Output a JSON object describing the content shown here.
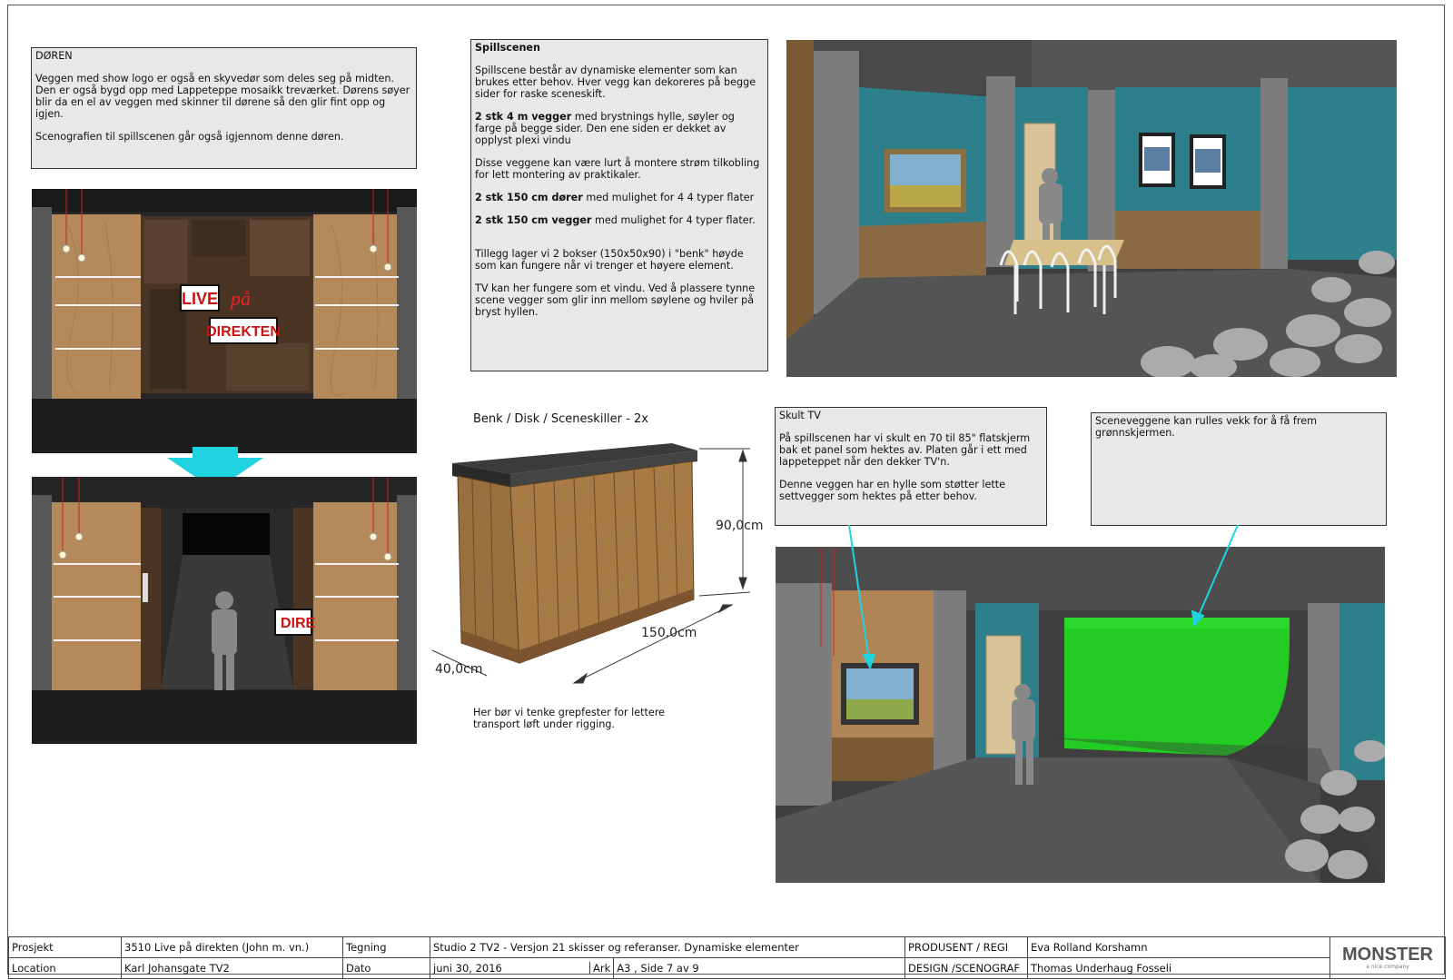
{
  "door_note": {
    "title": "DØREN",
    "p1": "Veggen med show logo er også en skyvedør som deles seg på midten. Den er også bygd opp med Lappeteppe mosaikk treværket. Dørens søyer blir da en el av veggen med skinner til dørene så den glir fint opp og igjen.",
    "p2": "Scenografien til spillscenen går også igjennom denne døren."
  },
  "stage_note": {
    "title": "Spillscenen",
    "intro": "Spillscene består av dynamiske elementer som kan brukes etter behov. Hver vegg kan dekoreres på begge sider for raske sceneskift.",
    "walls_bold": "2 stk 4 m vegger",
    "walls_rest": " med brystnings hylle, søyler og farge på begge sider. Den ene siden er dekket av opplyst plexi vindu",
    "power": "Disse veggene kan være lurt å montere strøm tilkobling for lett montering av praktikaler.",
    "doors_bold": "2 stk 150 cm dører",
    "doors_rest": " med mulighet for 4 4 typer flater",
    "walls150_bold": "2 stk 150 cm vegger",
    "walls150_rest": " med mulighet for 4 typer flater.",
    "boxes": "Tillegg lager vi 2 bokser (150x50x90) i \"benk\" høyde som kan fungere når vi trenger et høyere element.",
    "tv": "TV kan her fungere som et vindu. Ved å plassere tynne scene vegger som glir inn mellom søylene og hviler på bryst hyllen."
  },
  "bench": {
    "title": "Benk / Disk / Sceneskiller - 2x",
    "height": "90,0cm",
    "width": "150,0cm",
    "depth": "40,0cm",
    "caption": "Her bør vi tenke grepfester for lettere transport løft under rigging."
  },
  "tv_note": {
    "title": "Skult TV",
    "p1": "På spillscenen har vi skult en 70 til 85\" flatskjerm bak et panel som hektes av. Platen går i ett med lappeteppet når den dekker TV'n.",
    "p2": "Denne veggen har en hylle som støtter lette settvegger som hektes på etter behov."
  },
  "green_note": {
    "text": "Sceneveggene kan rulles vekk for å få frem grønnskjermen."
  },
  "signs": {
    "live": "LIVE",
    "pa": "på",
    "direkten": "DIREKTEN",
    "dire": "DIRE"
  },
  "titleblock": {
    "prosjekt_label": "Prosjekt",
    "prosjekt": "3510 Live på direkten (John m. vn.)",
    "tegning_label": "Tegning",
    "tegning": "Studio 2 TV2 - Versjon 21 skisser og referanser. Dynamiske elementer",
    "produsent_label": "PRODUSENT / REGI",
    "produsent": "Eva Rolland Korshamn",
    "location_label": "Location",
    "location": "Karl Johansgate TV2",
    "dato_label": "Dato",
    "dato": "juni 30, 2016",
    "ark_label": "Ark",
    "ark": "A3 , Side 7 av 9",
    "design_label": "DESIGN /SCENOGRAF",
    "design": "Thomas Underhaug Fosseli",
    "logo": "MONSTER",
    "logo_sub": "a nice company"
  },
  "colors": {
    "teal_wall": "#2e7f8c",
    "green_screen": "#22cc22",
    "arrow": "#1fd4e0",
    "sign_red": "#cc1111"
  }
}
